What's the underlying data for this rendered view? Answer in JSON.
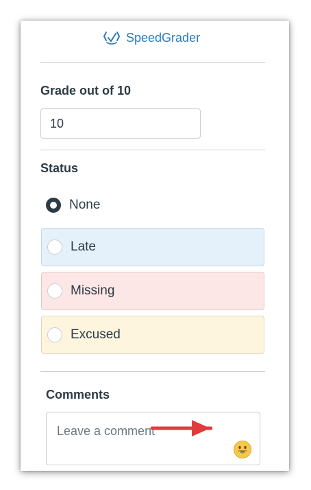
{
  "header": {
    "speedgrader_label": "SpeedGrader",
    "link_color": "#2b7abc"
  },
  "grade": {
    "label": "Grade out of 10",
    "value": "10"
  },
  "status": {
    "label": "Status",
    "selected": "None",
    "options": [
      {
        "label": "None",
        "background": "none"
      },
      {
        "label": "Late",
        "background": "#e5f1fa"
      },
      {
        "label": "Missing",
        "background": "#fde6e6"
      },
      {
        "label": "Excused",
        "background": "#fdf5de"
      }
    ]
  },
  "comments": {
    "label": "Comments",
    "placeholder": "Leave a comment",
    "emoji_icon": "smiley-emoji-icon",
    "annotation": "red arrow pointing to emoji button"
  }
}
